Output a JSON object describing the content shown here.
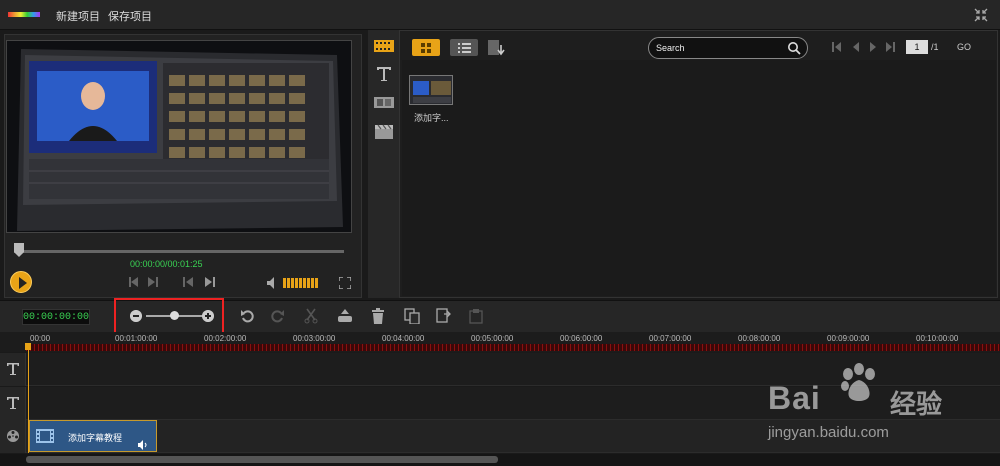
{
  "menu": {
    "new_project": "新建项目",
    "save_project": "保存项目"
  },
  "preview": {
    "timecode": "00:00:00/00:01:25",
    "volume_bars": 9
  },
  "library": {
    "search_placeholder": "Search",
    "page_current": "1",
    "page_total": "/1",
    "go_label": "GO",
    "items": [
      {
        "label": "添加字..."
      }
    ]
  },
  "timeline": {
    "current_time": "00:00:00:00",
    "zoom_level": 0.5,
    "ruler_labels": [
      "00:00",
      "00:01:00:00",
      "00:02:00:00",
      "00:03:00:00",
      "00:04:00:00",
      "00:05:00:00",
      "00:06:00:00",
      "00:07:00:00",
      "00:08:00:00",
      "00:09:00:00",
      "00:10:00:00"
    ],
    "tracks": [
      {
        "type": "text",
        "icon": "text-track-icon"
      },
      {
        "type": "text",
        "icon": "text-track-icon"
      },
      {
        "type": "video",
        "icon": "film-reel-icon"
      }
    ],
    "clip": {
      "label": "添加字幕教程"
    }
  },
  "watermark": {
    "brand": "Bai",
    "sub": "经验",
    "url": "jingyan.baidu.com"
  },
  "colors": {
    "accent": "#e8a317",
    "timecode": "#39d353",
    "highlight": "#e22222",
    "clip": "#2e5786"
  }
}
